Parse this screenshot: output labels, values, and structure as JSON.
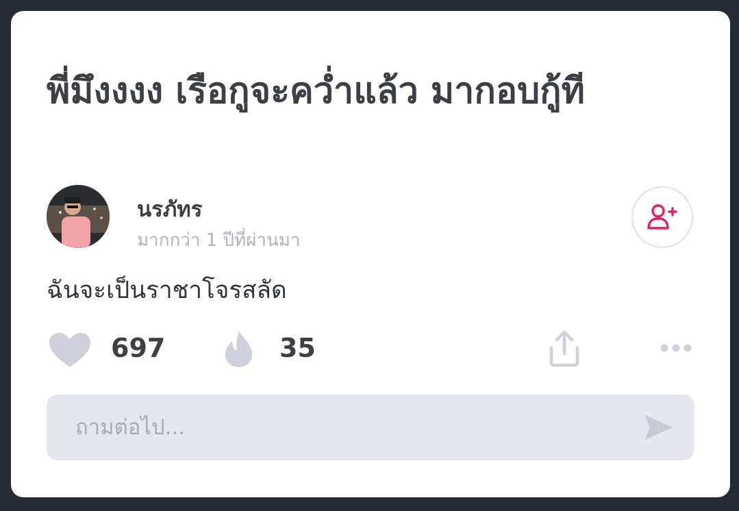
{
  "post": {
    "title": "พี่มึงงงง เรือกูจะคว่ำแล้ว มากอบกู้ที",
    "author": {
      "name": "นรภัทร",
      "timestamp": "มากกว่า 1 ปีที่ผ่านมา"
    },
    "body": "ฉันจะเป็นราชาโจรสลัด",
    "stats": {
      "likes": "697",
      "fires": "35"
    }
  },
  "ask_box": {
    "placeholder": "ถามต่อไป..."
  },
  "icons": {
    "like": "heart-icon",
    "fire": "fire-icon",
    "share": "share-icon",
    "more": "more-dots-icon",
    "follow": "add-user-icon",
    "send": "send-icon"
  },
  "colors": {
    "accent": "#e0245e",
    "icon_muted": "#cfd0da",
    "background": "#262b33"
  }
}
